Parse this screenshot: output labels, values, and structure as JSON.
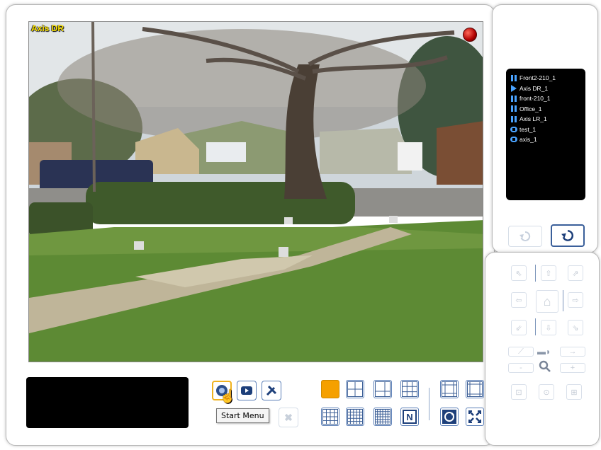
{
  "camera": {
    "label": "Axis DR"
  },
  "camera_list": [
    {
      "name": "Front2-210_1",
      "state": "paused"
    },
    {
      "name": "Axis DR_1",
      "state": "playing"
    },
    {
      "name": "front-210_1",
      "state": "paused"
    },
    {
      "name": "Office_1",
      "state": "paused"
    },
    {
      "name": "Axis LR_1",
      "state": "paused"
    },
    {
      "name": "test_1",
      "state": "recording"
    },
    {
      "name": "axis_1",
      "state": "recording"
    }
  ],
  "tooltip": {
    "text": "Start Menu"
  },
  "toolbar": {
    "start_icon": "start-menu-icon",
    "playback_icon": "playback-icon",
    "tools_icon": "tools-icon",
    "close_icon": "close-icon"
  },
  "layout_buttons": {
    "n_label": "N"
  },
  "ptz": {
    "zoom_icon": "magnifier-icon"
  },
  "colors": {
    "accent": "#3a5f9a",
    "selected_layout": "#f5a000",
    "list_icon": "#4aa3ff",
    "label": "#ffe600"
  }
}
